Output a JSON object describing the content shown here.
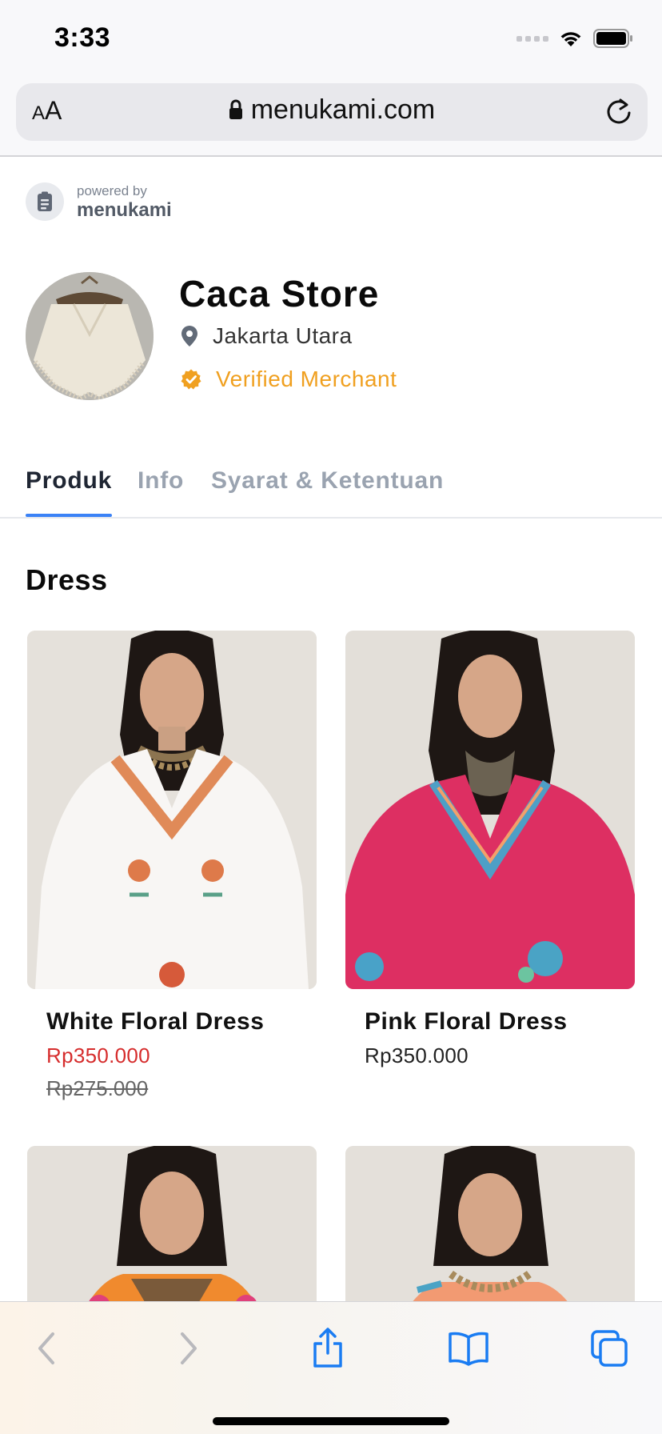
{
  "status_bar": {
    "time": "3:33"
  },
  "browser": {
    "aa_small": "A",
    "aa_large": "A",
    "url": "menukami.com"
  },
  "powered": {
    "small": "powered by",
    "brand": "menukami"
  },
  "store": {
    "name": "Caca Store",
    "location": "Jakarta Utara",
    "verified_label": "Verified Merchant"
  },
  "tabs": [
    {
      "label": "Produk"
    },
    {
      "label": "Info"
    },
    {
      "label": "Syarat & Ketentuan"
    }
  ],
  "section": {
    "title": "Dress"
  },
  "products": [
    {
      "name": "White Floral Dress",
      "price": "Rp350.000",
      "old_price": "Rp275.000"
    },
    {
      "name": "Pink Floral Dress",
      "price": "Rp350.000"
    }
  ],
  "colors": {
    "accent": "#3b82f6",
    "verified": "#f0a020",
    "sale_price": "#d62d2d",
    "ios_blue": "#1a7cf2"
  }
}
